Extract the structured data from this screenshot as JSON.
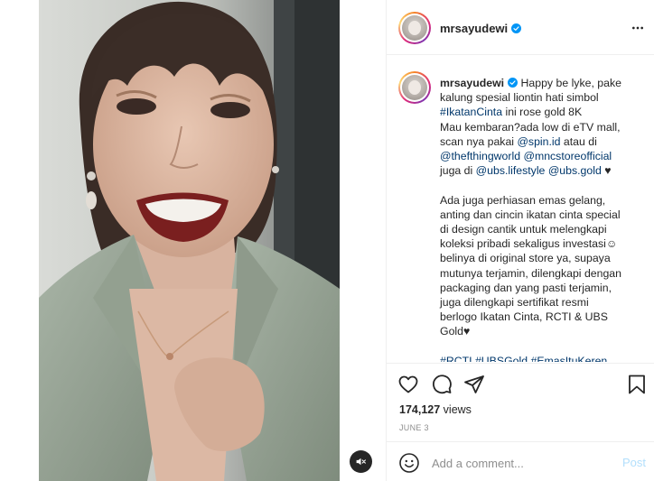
{
  "post": {
    "username": "mrsayudewi",
    "verified": true,
    "caption_lines": [
      [
        {
          "t": "Happy be lyke, pake",
          "k": "text"
        }
      ],
      [
        {
          "t": "kalung spesial liontin hati simbol",
          "k": "text"
        }
      ],
      [
        {
          "t": "#IkatanCinta",
          "k": "tag"
        },
        {
          "t": " ini rose gold 8K",
          "k": "text"
        }
      ],
      [
        {
          "t": "Mau kembaran?ada low di eTV mall,",
          "k": "text"
        }
      ],
      [
        {
          "t": "scan nya pakai ",
          "k": "text"
        },
        {
          "t": "@spin.id",
          "k": "tag"
        },
        {
          "t": " atau di",
          "k": "text"
        }
      ],
      [
        {
          "t": "@thefthingworld",
          "k": "tag"
        },
        {
          "t": " ",
          "k": "text"
        },
        {
          "t": "@mncstoreofficial",
          "k": "tag"
        }
      ],
      [
        {
          "t": "juga di ",
          "k": "text"
        },
        {
          "t": "@ubs.lifestyle",
          "k": "tag"
        },
        {
          "t": " ",
          "k": "text"
        },
        {
          "t": "@ubs.gold",
          "k": "tag"
        },
        {
          "t": " ♥",
          "k": "text"
        }
      ],
      [
        {
          "t": "",
          "k": "text"
        }
      ],
      [
        {
          "t": "Ada juga perhiasan emas gelang,",
          "k": "text"
        }
      ],
      [
        {
          "t": "anting dan cincin ikatan cinta special",
          "k": "text"
        }
      ],
      [
        {
          "t": "di design cantik untuk melengkapi",
          "k": "text"
        }
      ],
      [
        {
          "t": "koleksi pribadi sekaligus investasi☺",
          "k": "text"
        }
      ],
      [
        {
          "t": "belinya di original store ya, supaya",
          "k": "text"
        }
      ],
      [
        {
          "t": "mutunya terjamin, dilengkapi dengan",
          "k": "text"
        }
      ],
      [
        {
          "t": "packaging dan yang pasti terjamin,",
          "k": "text"
        }
      ],
      [
        {
          "t": "juga dilengkapi sertifikat resmi",
          "k": "text"
        }
      ],
      [
        {
          "t": "berlogo Ikatan Cinta, RCTI & UBS",
          "k": "text"
        }
      ],
      [
        {
          "t": "Gold♥",
          "k": "text"
        }
      ],
      [
        {
          "t": "",
          "k": "text"
        }
      ],
      [
        {
          "t": "#RCTI",
          "k": "tag"
        },
        {
          "t": " ",
          "k": "text"
        },
        {
          "t": "#UBSGold",
          "k": "tag"
        },
        {
          "t": " ",
          "k": "text"
        },
        {
          "t": "#EmasItuKeren",
          "k": "tag"
        }
      ]
    ],
    "views_count": "174,127",
    "views_label": "views",
    "date": "JUNE 3"
  },
  "comment": {
    "placeholder": "Add a comment...",
    "post_label": "Post"
  },
  "colors": {
    "link": "#00376b",
    "verified": "#0095f6",
    "post_disabled": "#b2dffc"
  },
  "icons": {
    "more": "more-options-icon",
    "like": "heart-icon",
    "comment": "comment-icon",
    "share": "send-icon",
    "save": "bookmark-icon",
    "emoji": "emoji-icon",
    "mute": "muted-speaker-icon"
  }
}
